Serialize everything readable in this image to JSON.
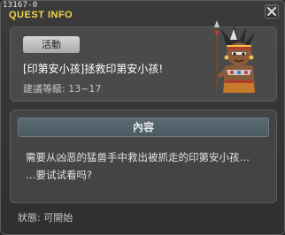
{
  "window": {
    "quest_code": "13167-0",
    "title": "QUEST INFO"
  },
  "quest": {
    "status_tag": "活動",
    "name": "[印第安小孩]拯救印第安小孩!",
    "level_range": "建議等級: 13~17"
  },
  "content": {
    "header": "內容",
    "lines": [
      "需要从凶恶的猛兽手中救出被抓走的印第安小孩…",
      "…要试试看吗?"
    ]
  },
  "status": {
    "text": "狀態: 可開始"
  },
  "icons": {
    "close": "close-icon",
    "portrait": "npc-portrait"
  }
}
